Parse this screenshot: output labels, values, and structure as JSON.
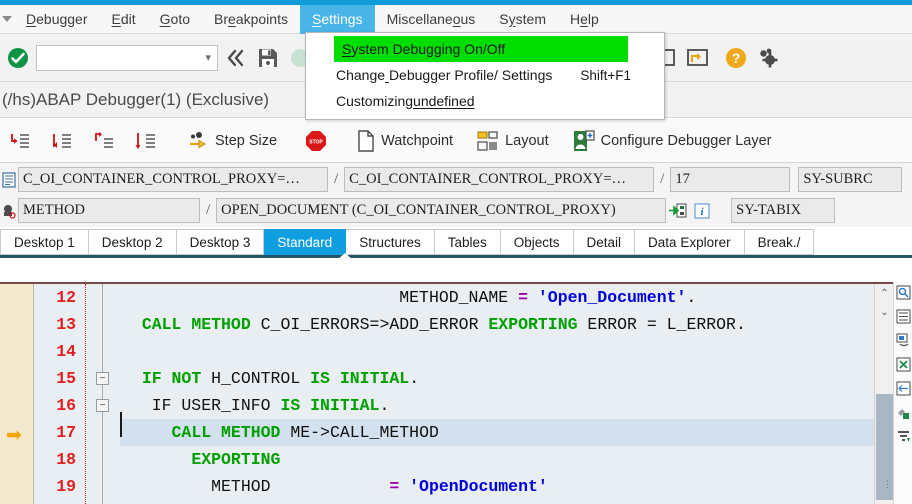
{
  "window": {
    "title": "(/hs)ABAP Debugger(1)  (Exclusive)"
  },
  "menubar": {
    "items": [
      {
        "label": "Debugger",
        "accel_index": 0,
        "active": false,
        "name": "menu-debugger"
      },
      {
        "label": "Edit",
        "accel_index": 0,
        "active": false,
        "name": "menu-edit"
      },
      {
        "label": "Goto",
        "accel_index": 0,
        "active": false,
        "name": "menu-goto"
      },
      {
        "label": "Breakpoints",
        "accel_index": 2,
        "active": false,
        "name": "menu-breakpoints"
      },
      {
        "label": "Settings",
        "accel_index": 0,
        "active": true,
        "name": "menu-settings"
      },
      {
        "label": "Miscellaneous",
        "accel_index": 10,
        "active": false,
        "name": "menu-miscellaneous"
      },
      {
        "label": "System",
        "accel_index": 1,
        "active": false,
        "name": "menu-system"
      },
      {
        "label": "Help",
        "accel_index": 1,
        "active": false,
        "name": "menu-help"
      }
    ]
  },
  "dropdown": {
    "open_menu": "Settings",
    "items": [
      {
        "label": "System Debugging On/Off",
        "shortcut": "",
        "highlighted": true
      },
      {
        "label": "Change Debugger Profile/ Settings",
        "shortcut": "Shift+F1",
        "highlighted": false
      },
      {
        "label": "Customizing",
        "shortcut": "",
        "highlighted": false
      }
    ],
    "highlight_color": "#00dd00"
  },
  "toolbar_main": {
    "command_field": {
      "value": "",
      "placeholder": ""
    },
    "icons": [
      {
        "name": "enter-check-icon",
        "title": "Enter"
      },
      {
        "name": "command-dropdown-icon",
        "title": "Command field dropdown"
      },
      {
        "name": "back-double-arrow-icon",
        "title": "Back"
      },
      {
        "name": "save-icon",
        "title": "Save"
      },
      {
        "name": "exit-icon",
        "title": "Exit"
      },
      {
        "name": "new-window-icon",
        "title": "New window"
      },
      {
        "name": "restore-window-icon",
        "title": "Restore window"
      },
      {
        "name": "help-icon",
        "title": "Help"
      },
      {
        "name": "customize-gear-icon",
        "title": "Customize local layout"
      }
    ]
  },
  "toolbar_debug": {
    "buttons": [
      {
        "label": "",
        "icon": "step-into-icon",
        "name": "step-into-button"
      },
      {
        "label": "",
        "icon": "step-over-icon",
        "name": "step-over-button"
      },
      {
        "label": "",
        "icon": "step-return-icon",
        "name": "step-return-button"
      },
      {
        "label": "",
        "icon": "continue-icon",
        "name": "continue-button"
      },
      {
        "label": "Step Size",
        "icon": "step-size-icon",
        "name": "step-size-button"
      },
      {
        "label": "",
        "icon": "stop-icon",
        "name": "stop-button"
      },
      {
        "label": "Watchpoint",
        "icon": "watchpoint-icon",
        "name": "watchpoint-button"
      },
      {
        "label": "Layout",
        "icon": "layout-icon",
        "name": "layout-button"
      },
      {
        "label": "Configure Debugger Layer",
        "icon": "configure-layer-icon",
        "name": "configure-debugger-layer-button"
      }
    ]
  },
  "field_rows": {
    "row1": {
      "icon": "program-icon",
      "field1": "C_OI_CONTAINER_CONTROL_PROXY=…",
      "field2": "C_OI_CONTAINER_CONTROL_PROXY=…",
      "field3": "17",
      "field4": "SY-SUBRC"
    },
    "row2": {
      "icon": "method-icon",
      "field1": "METHOD",
      "field2": "OPEN_DOCUMENT (C_OI_CONTAINER_CONTROL_PROXY)",
      "icon2": "goto-source-icon",
      "icon3": "info-icon",
      "field4": "SY-TABIX"
    }
  },
  "tabs": {
    "items": [
      {
        "label": "Desktop 1",
        "active": false
      },
      {
        "label": "Desktop 2",
        "active": false
      },
      {
        "label": "Desktop 3",
        "active": false
      },
      {
        "label": "Standard",
        "active": true
      },
      {
        "label": "Structures",
        "active": false
      },
      {
        "label": "Tables",
        "active": false
      },
      {
        "label": "Objects",
        "active": false
      },
      {
        "label": "Detail",
        "active": false
      },
      {
        "label": "Data Explorer",
        "active": false
      },
      {
        "label": "Break./",
        "active": false
      }
    ],
    "active_color": "#0f9fe0"
  },
  "editor": {
    "current_line": 17,
    "lines": [
      {
        "no": "12",
        "fold": false,
        "current": false,
        "segments": [
          {
            "t": "                            METHOD_NAME ",
            "c": "plain"
          },
          {
            "t": "= ",
            "c": "op"
          },
          {
            "t": "'Open_Document'",
            "c": "str"
          },
          {
            "t": ".",
            "c": "plain"
          }
        ]
      },
      {
        "no": "13",
        "fold": false,
        "current": false,
        "segments": [
          {
            "t": "  ",
            "c": "plain"
          },
          {
            "t": "CALL METHOD ",
            "c": "kw"
          },
          {
            "t": "C_OI_ERRORS=>ADD_ERROR ",
            "c": "plain"
          },
          {
            "t": "EXPORTING ",
            "c": "kw"
          },
          {
            "t": "ERROR = L_ERROR.",
            "c": "plain"
          }
        ]
      },
      {
        "no": "14",
        "fold": false,
        "current": false,
        "segments": [
          {
            "t": "",
            "c": "plain"
          }
        ]
      },
      {
        "no": "15",
        "fold": true,
        "current": false,
        "segments": [
          {
            "t": "  ",
            "c": "plain"
          },
          {
            "t": "IF NOT ",
            "c": "kw"
          },
          {
            "t": "H_CONTROL ",
            "c": "plain"
          },
          {
            "t": "IS INITIAL",
            "c": "kw"
          },
          {
            "t": ".",
            "c": "plain"
          }
        ]
      },
      {
        "no": "16",
        "fold": true,
        "current": false,
        "segments": [
          {
            "t": "   IF USER_INFO ",
            "c": "plain"
          },
          {
            "t": "IS INITIAL",
            "c": "kw"
          },
          {
            "t": ".",
            "c": "plain"
          }
        ]
      },
      {
        "no": "17",
        "fold": false,
        "current": true,
        "segments": [
          {
            "t": "     ",
            "c": "plain"
          },
          {
            "t": "CALL METHOD ",
            "c": "kw"
          },
          {
            "t": "ME->CALL_METHOD",
            "c": "plain"
          }
        ]
      },
      {
        "no": "18",
        "fold": false,
        "current": false,
        "segments": [
          {
            "t": "       ",
            "c": "plain"
          },
          {
            "t": "EXPORTING",
            "c": "kw"
          }
        ]
      },
      {
        "no": "19",
        "fold": false,
        "current": false,
        "segments": [
          {
            "t": "         METHOD            ",
            "c": "plain"
          },
          {
            "t": "= ",
            "c": "op"
          },
          {
            "t": "'OpenDocument'",
            "c": "str"
          }
        ]
      }
    ],
    "scrollbar": {
      "up": "⌃",
      "down": "⌄"
    }
  },
  "right_rail": {
    "icons": [
      {
        "name": "find-icon"
      },
      {
        "name": "list-icon"
      },
      {
        "name": "session-icon"
      },
      {
        "name": "export-excel-icon"
      },
      {
        "name": "indent-icon"
      },
      {
        "name": "pencil-icon"
      },
      {
        "name": "sort-icon"
      }
    ]
  }
}
